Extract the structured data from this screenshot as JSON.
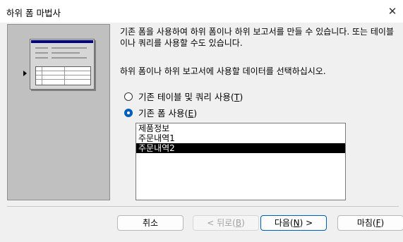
{
  "window": {
    "title": "하위 폼 마법사",
    "close_glyph": "✕"
  },
  "description": "기존 폼을 사용하여 하위 폼이나 하위 보고서를 만들 수 있습니다. 또는 테이블이나 쿼리를 사용할 수도 있습니다.",
  "prompt": "하위 폼이나 하위 보고서에 사용할 데이터를 선택하십시오.",
  "options": [
    {
      "label_pre": "기존 테이블 및 쿼리 사용(",
      "key": "T",
      "label_post": ")",
      "selected": false
    },
    {
      "label_pre": "기존 폼 사용(",
      "key": "E",
      "label_post": ")",
      "selected": true
    }
  ],
  "forms_list": {
    "items": [
      "제품정보",
      "주문내역1",
      "주문내역2"
    ],
    "selected": "주문내역2"
  },
  "buttons": {
    "cancel": {
      "label": "취소"
    },
    "back": {
      "pre": "< 뒤로(",
      "key": "B",
      "post": ")",
      "enabled": false
    },
    "next": {
      "pre": "다음(",
      "key": "N",
      "post": ") >"
    },
    "finish": {
      "pre": "마침(",
      "key": "F",
      "post": ")"
    }
  },
  "colors": {
    "accent": "#005fb8",
    "selection": "#000000",
    "preview_bg": "#c0c0c0"
  }
}
